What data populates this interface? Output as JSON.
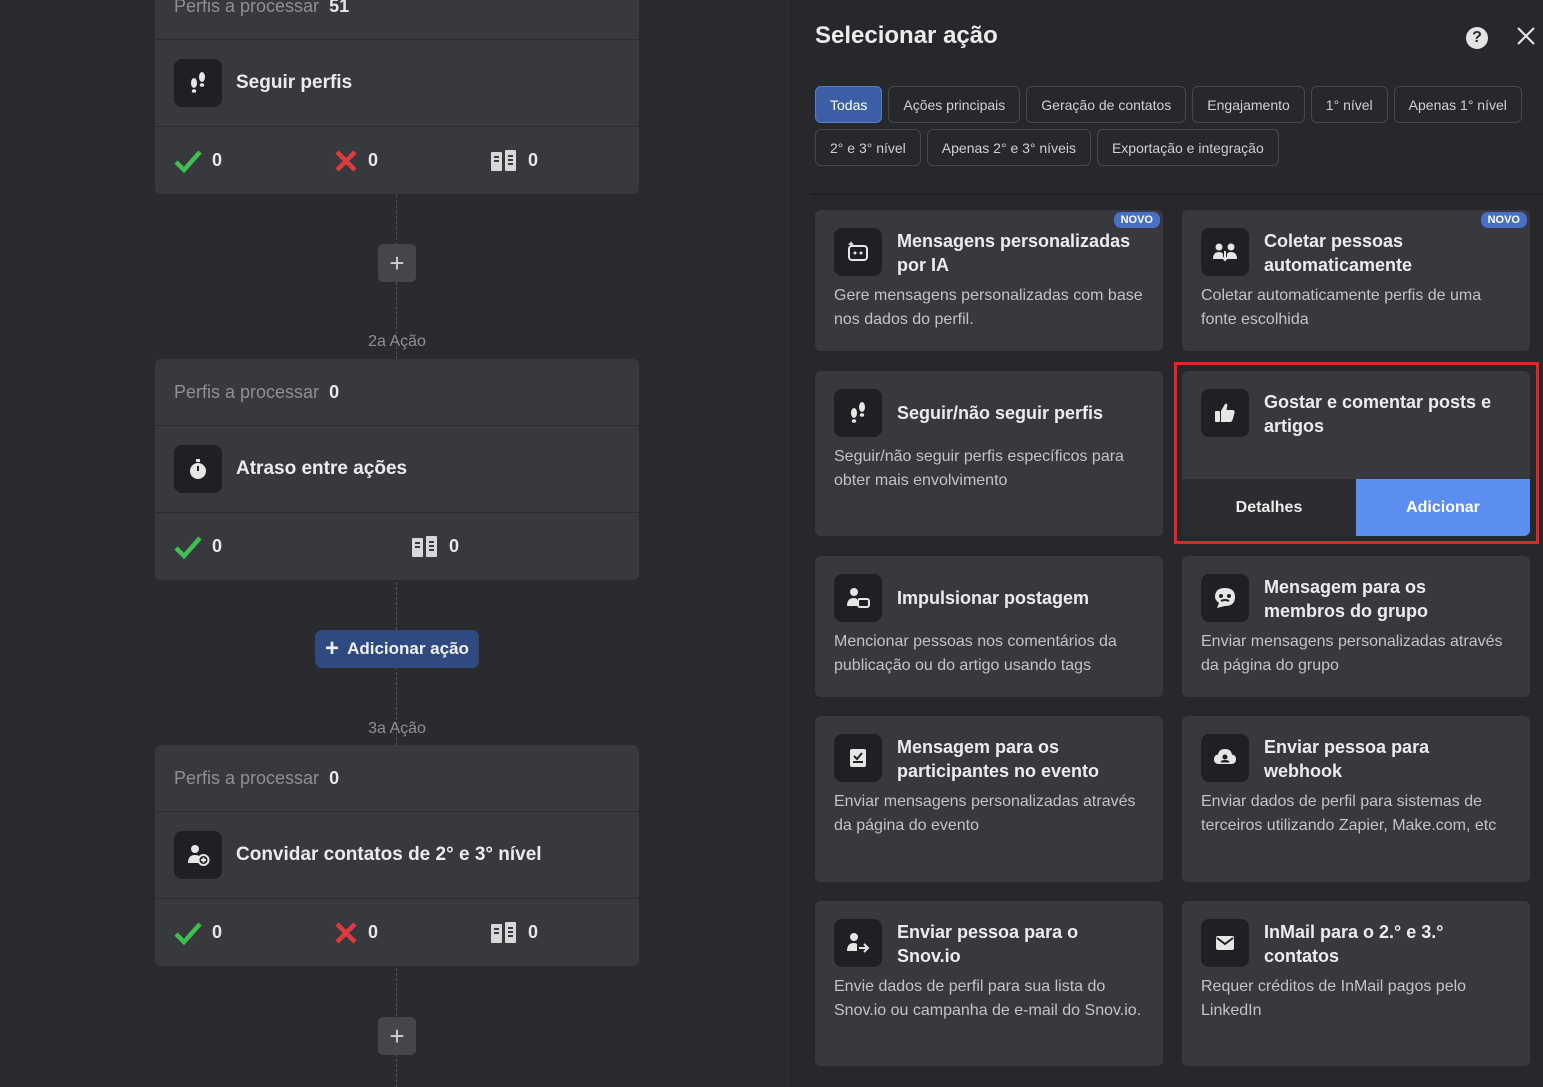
{
  "workflow": {
    "card1": {
      "header_label": "Perfis a processar",
      "header_count": "51",
      "action": "Seguir perfis",
      "stats": {
        "success": "0",
        "fail": "0",
        "skip": "0"
      }
    },
    "step2_label": "2a Ação",
    "card2": {
      "header_label": "Perfis a processar",
      "header_count": "0",
      "action": "Atraso entre ações",
      "stats": {
        "success": "0",
        "skip": "0"
      }
    },
    "add_action_label": "Adicionar ação",
    "step3_label": "3a Ação",
    "card3": {
      "header_label": "Perfis a processar",
      "header_count": "0",
      "action": "Convidar contatos de 2° e 3° nível",
      "stats": {
        "success": "0",
        "fail": "0",
        "skip": "0"
      }
    }
  },
  "panel": {
    "title": "Selecionar ação",
    "filters": [
      "Todas",
      "Ações principais",
      "Geração de contatos",
      "Engajamento",
      "1° nível",
      "Apenas 1° nível",
      "2° e 3° nível",
      "Apenas 2° e 3° níveis",
      "Exportação e integração"
    ],
    "cards": [
      {
        "title": "Mensagens personalizadas por IA",
        "desc": "Gere mensagens personalizadas com base nos dados do perfil.",
        "badge": "NOVO",
        "icon": "ai-message-icon"
      },
      {
        "title": "Coletar pessoas automaticamente",
        "desc": "Coletar automaticamente perfis de uma fonte escolhida",
        "badge": "NOVO",
        "icon": "collect-people-icon"
      },
      {
        "title": "Seguir/não seguir perfis",
        "desc": "Seguir/não seguir perfis específicos para obter mais envolvimento",
        "icon": "footprints-icon"
      },
      {
        "title": "Gostar e comentar posts e artigos",
        "details_label": "Detalhes",
        "add_label": "Adicionar",
        "icon": "thumbs-up-icon"
      },
      {
        "title": "Impulsionar postagem",
        "desc": "Mencionar pessoas nos comentários da publicação ou do artigo usando tags",
        "icon": "tag-person-icon"
      },
      {
        "title": "Mensagem para os membros do grupo",
        "desc": "Enviar mensagens personalizadas através da página do grupo",
        "icon": "group-chat-icon"
      },
      {
        "title": "Mensagem para os participantes no evento",
        "desc": "Enviar mensagens personalizadas através da página do evento",
        "icon": "event-message-icon"
      },
      {
        "title": "Enviar pessoa para webhook",
        "desc": "Enviar dados de perfil para sistemas de terceiros utilizando Zapier, Make.com, etc",
        "icon": "webhook-icon"
      },
      {
        "title": "Enviar pessoa para o Snov.io",
        "desc": "Envie dados de perfil para sua lista do Snov.io ou campanha de e-mail do Snov.io.",
        "icon": "person-send-icon"
      },
      {
        "title": "InMail para o 2.° e 3.° contatos",
        "desc": "Requer créditos de InMail pagos pelo LinkedIn",
        "icon": "mail-icon"
      }
    ]
  }
}
